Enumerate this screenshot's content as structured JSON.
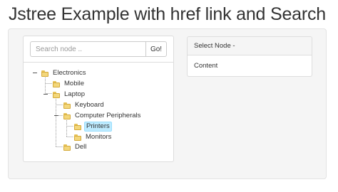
{
  "page": {
    "title": "Jstree Example with href link and Search"
  },
  "search": {
    "placeholder": "Search node ..",
    "value": "",
    "button_label": "Go!"
  },
  "tree": {
    "nodes": [
      {
        "label": "Electronics",
        "level": 0,
        "expanded": true
      },
      {
        "label": "Mobile",
        "level": 1
      },
      {
        "label": "Laptop",
        "level": 1,
        "expanded": true
      },
      {
        "label": "Keyboard",
        "level": 2
      },
      {
        "label": "Computer Peripherals",
        "level": 2,
        "expanded": true
      },
      {
        "label": "Printers",
        "level": 3,
        "selected": true
      },
      {
        "label": "Monitors",
        "level": 3
      },
      {
        "label": "Dell",
        "level": 2
      }
    ]
  },
  "detail": {
    "heading": "Select Node -",
    "content": "Content"
  },
  "colors": {
    "selection_bg": "#beebff",
    "folder": "#f3d77b",
    "well_bg": "#f5f5f5"
  }
}
